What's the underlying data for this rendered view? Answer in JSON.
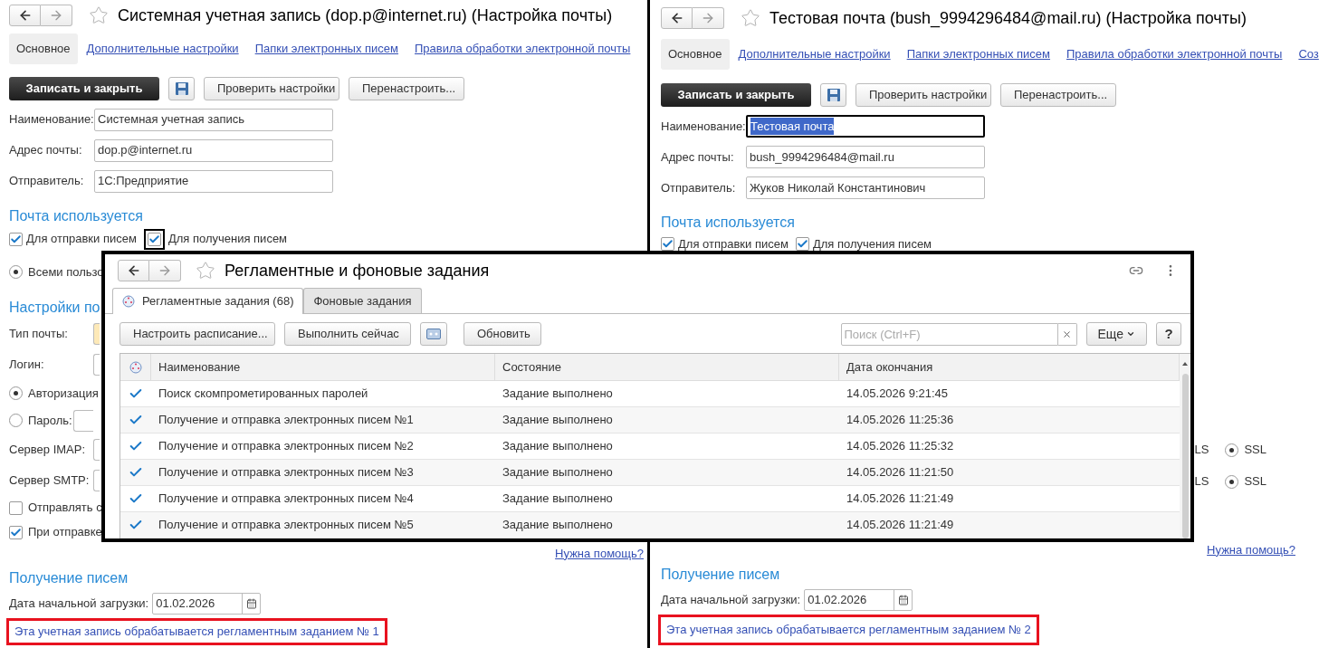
{
  "mail_windows": [
    {
      "title": "Системная учетная запись (dop.p@internet.ru) (Настройка почты)",
      "tabs": [
        {
          "label": "Основное",
          "selected": true
        },
        {
          "label": "Дополнительные настройки",
          "selected": false
        },
        {
          "label": "Папки электронных писем",
          "selected": false
        },
        {
          "label": "Правила обработки электронной почты",
          "selected": false
        }
      ],
      "buttons": {
        "primary": "Записать и закрыть",
        "check": "Проверить настройки",
        "reconfigure": "Перенастроить..."
      },
      "fields": [
        {
          "label": "Наименование:",
          "value": "Системная учетная запись",
          "focused": false
        },
        {
          "label": "Адрес почты:",
          "value": "dop.p@internet.ru",
          "focused": false
        },
        {
          "label": "Отправитель:",
          "value": "1С:Предприятие",
          "focused": false
        }
      ],
      "section_title": "Почта используется",
      "checkboxes": [
        {
          "label": "Для отправки писем",
          "checked": true,
          "focused": false
        },
        {
          "label": "Для получения писем",
          "checked": true,
          "focused": true
        }
      ],
      "partial_rows": [
        {
          "kind": "radio",
          "label": "Всеми пользо",
          "selected": true
        },
        {
          "kind": "heading",
          "label": "Настройки по"
        },
        {
          "kind": "field",
          "label": "Тип почты:",
          "highlighted": true
        },
        {
          "kind": "field",
          "label": "Логин:",
          "highlighted": false
        },
        {
          "kind": "radio",
          "label": "Авторизация",
          "selected": true
        },
        {
          "kind": "radio_field",
          "label": "Пароль:",
          "selected": false
        },
        {
          "kind": "field",
          "label": "Сервер IMAP:",
          "highlighted": false
        },
        {
          "kind": "field",
          "label": "Сервер SMTP:",
          "highlighted": false
        },
        {
          "kind": "checkbox",
          "label": "Отправлять с",
          "checked": false
        },
        {
          "kind": "checkbox",
          "label": "При отправке",
          "checked": true
        }
      ],
      "help_link": "Нужна помощь?",
      "receive": {
        "title": "Получение писем",
        "date_label": "Дата начальной загрузки:",
        "date_value": "01.02.2026"
      },
      "note": "Эта учетная запись обрабатывается регламентным заданием № 1"
    },
    {
      "title": "Тестовая почта (bush_9994296484@mail.ru) (Настройка почты)",
      "tabs": [
        {
          "label": "Основное",
          "selected": true
        },
        {
          "label": "Дополнительные настройки",
          "selected": false
        },
        {
          "label": "Папки электронных писем",
          "selected": false
        },
        {
          "label": "Правила обработки электронной почты",
          "selected": false
        },
        {
          "label": "Соз",
          "selected": false
        }
      ],
      "buttons": {
        "primary": "Записать и закрыть",
        "check": "Проверить настройки",
        "reconfigure": "Перенастроить..."
      },
      "fields": [
        {
          "label": "Наименование:",
          "value": "Тестовая почта",
          "focused": true
        },
        {
          "label": "Адрес почты:",
          "value": "bush_9994296484@mail.ru",
          "focused": false
        },
        {
          "label": "Отправитель:",
          "value": "Жуков Николай Константинович",
          "focused": false
        }
      ],
      "section_title": "Почта используется",
      "checkboxes": [
        {
          "label": "Для отправки писем",
          "checked": true,
          "focused": false
        },
        {
          "label": "Для получения писем",
          "checked": true,
          "focused": false
        }
      ],
      "partial_rows": [
        {
          "kind": "protocol",
          "label": "LS",
          "option": "SSL",
          "selected": true
        },
        {
          "kind": "protocol",
          "label": "LS",
          "option": "SSL",
          "selected": true
        }
      ],
      "help_link": "Нужна помощь?",
      "receive": {
        "title": "Получение писем",
        "date_label": "Дата начальной загрузки:",
        "date_value": "01.02.2026"
      },
      "note": "Эта учетная запись обрабатывается регламентным заданием № 2"
    }
  ],
  "jobs_window": {
    "title": "Регламентные и фоновые задания",
    "tabs": [
      {
        "label": "Регламентные задания (68)",
        "selected": true
      },
      {
        "label": "Фоновые задания",
        "selected": false
      }
    ],
    "toolbar": {
      "schedule": "Настроить расписание...",
      "run": "Выполнить сейчас",
      "refresh": "Обновить",
      "search_placeholder": "Поиск (Ctrl+F)",
      "more": "Еще",
      "help": "?"
    },
    "columns": [
      "Наименование",
      "Состояние",
      "Дата окончания"
    ],
    "rows": [
      {
        "enabled": true,
        "name": "Поиск скомпрометированных паролей",
        "state": "Задание выполнено",
        "date": "14.05.2026 9:21:45"
      },
      {
        "enabled": true,
        "name": "Получение и отправка электронных писем №1",
        "state": "Задание выполнено",
        "date": "14.05.2026 11:25:36"
      },
      {
        "enabled": true,
        "name": "Получение и отправка электронных писем №2",
        "state": "Задание выполнено",
        "date": "14.05.2026 11:25:32"
      },
      {
        "enabled": true,
        "name": "Получение и отправка электронных писем №3",
        "state": "Задание выполнено",
        "date": "14.05.2026 11:21:50"
      },
      {
        "enabled": true,
        "name": "Получение и отправка электронных писем №4",
        "state": "Задание выполнено",
        "date": "14.05.2026 11:21:49"
      },
      {
        "enabled": true,
        "name": "Получение и отправка электронных писем №5",
        "state": "Задание выполнено",
        "date": "14.05.2026 11:21:49"
      }
    ]
  }
}
